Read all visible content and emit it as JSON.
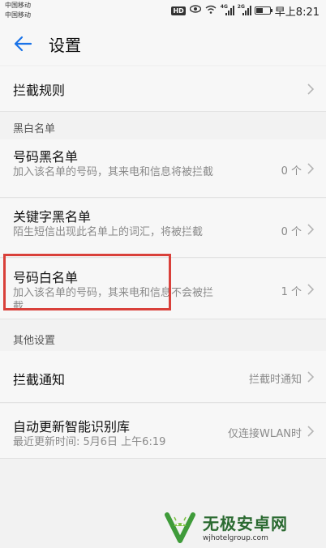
{
  "status_bar": {
    "carrier_1": "中国移动",
    "carrier_2": "中国移动",
    "hd": "HD",
    "time": "早上8:21"
  },
  "header": {
    "title": "设置"
  },
  "rows": {
    "block_rules": {
      "label": "拦截规则"
    },
    "blacklist": {
      "label": "号码黑名单",
      "sub": "加入该名单的号码，其来电和信息将被拦截",
      "value": "0 个"
    },
    "keyword_blacklist": {
      "label": "关键字黑名单",
      "sub": "陌生短信出现此名单上的词汇，将被拦截",
      "value": "0 个"
    },
    "whitelist": {
      "label": "号码白名单",
      "sub": "加入该名单的号码，其来电和信息不会被拦截",
      "value": "1 个"
    },
    "block_notification": {
      "label": "拦截通知",
      "value": "拦截时通知"
    },
    "auto_update": {
      "label": "自动更新智能识别库",
      "sub": "最近更新时间: 5月6日 上午6:19",
      "value": "仅连接WLAN时"
    }
  },
  "sections": {
    "black_white": "黑白名单",
    "other": "其他设置"
  },
  "watermark": {
    "title": "无极安卓网",
    "url": "wjhotelgroup.com"
  },
  "colors": {
    "accent": "#1a73e8",
    "highlight": "#d9403a",
    "brand": "#2b6a31"
  }
}
